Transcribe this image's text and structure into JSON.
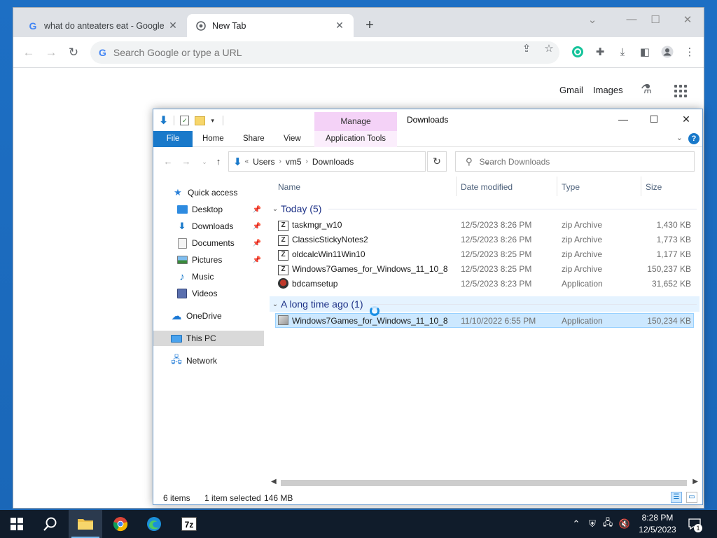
{
  "chrome": {
    "tabs": [
      {
        "title": "what do anteaters eat - Google S",
        "close": "✕"
      },
      {
        "title": "New Tab",
        "close": "✕"
      }
    ],
    "new_tab": "+",
    "omnibox_placeholder": "Search Google or type a URL",
    "ntp_links": {
      "gmail": "Gmail",
      "images": "Images"
    }
  },
  "explorer": {
    "title": "Downloads",
    "manage_label": "Manage",
    "ribbon_tabs": {
      "file": "File",
      "home": "Home",
      "share": "Share",
      "view": "View",
      "app_tools": "Application Tools"
    },
    "address": {
      "lead": "«",
      "crumbs": [
        "Users",
        "vm5",
        "Downloads"
      ]
    },
    "search_placeholder": "Search Downloads",
    "nav": {
      "quick_access": "Quick access",
      "desktop": "Desktop",
      "downloads": "Downloads",
      "documents": "Documents",
      "pictures": "Pictures",
      "music": "Music",
      "videos": "Videos",
      "onedrive": "OneDrive",
      "this_pc": "This PC",
      "network": "Network"
    },
    "columns": {
      "name": "Name",
      "date": "Date modified",
      "type": "Type",
      "size": "Size"
    },
    "groups": [
      {
        "label": "Today (5)",
        "files": [
          {
            "name": "taskmgr_w10",
            "date": "12/5/2023 8:26 PM",
            "type": "zip Archive",
            "size": "1,430 KB"
          },
          {
            "name": "ClassicStickyNotes2",
            "date": "12/5/2023 8:26 PM",
            "type": "zip Archive",
            "size": "1,773 KB"
          },
          {
            "name": "oldcalcWin11Win10",
            "date": "12/5/2023 8:25 PM",
            "type": "zip Archive",
            "size": "1,177 KB"
          },
          {
            "name": "Windows7Games_for_Windows_11_10_8",
            "date": "12/5/2023 8:25 PM",
            "type": "zip Archive",
            "size": "150,237 KB"
          },
          {
            "name": "bdcamsetup",
            "date": "12/5/2023 8:23 PM",
            "type": "Application",
            "size": "31,652 KB"
          }
        ]
      },
      {
        "label": "A long time ago (1)",
        "files": [
          {
            "name": "Windows7Games_for_Windows_11_10_8",
            "date": "11/10/2022 6:55 PM",
            "type": "Application",
            "size": "150,234 KB"
          }
        ]
      }
    ],
    "status": {
      "items": "6 items",
      "selected": "1 item selected",
      "size": "146 MB"
    }
  },
  "taskbar": {
    "time": "8:28 PM",
    "date": "12/5/2023",
    "seven_zip": "7z",
    "notification_count": "1"
  }
}
